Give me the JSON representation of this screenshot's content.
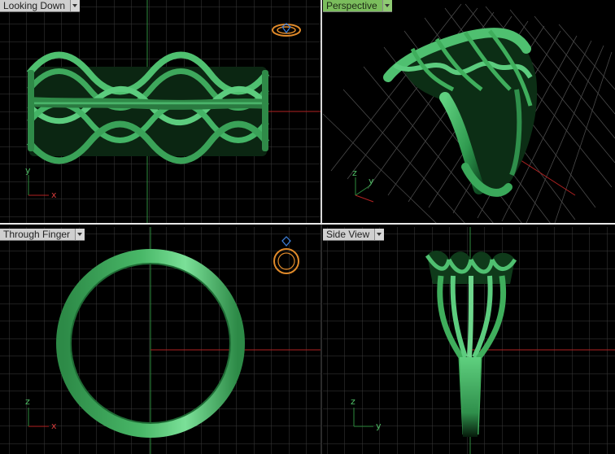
{
  "viewports": [
    {
      "title": "Looking Down",
      "active": false
    },
    {
      "title": "Perspective",
      "active": true
    },
    {
      "title": "Through Finger",
      "active": false
    },
    {
      "title": "Side View",
      "active": false
    }
  ],
  "axes": {
    "top": {
      "v": "y",
      "h": "x"
    },
    "perspective": {
      "v": "z",
      "h": "y"
    },
    "front": {
      "v": "z",
      "h": "x"
    },
    "right": {
      "v": "z",
      "h": "y"
    }
  },
  "colors": {
    "grid": "#3a3a3a",
    "grid_major": "#5a5a5a",
    "x_axis": "#b22222",
    "y_axis": "#2e8b3e",
    "model": "#3fae5c",
    "active_tab": "#7bbd5d"
  }
}
